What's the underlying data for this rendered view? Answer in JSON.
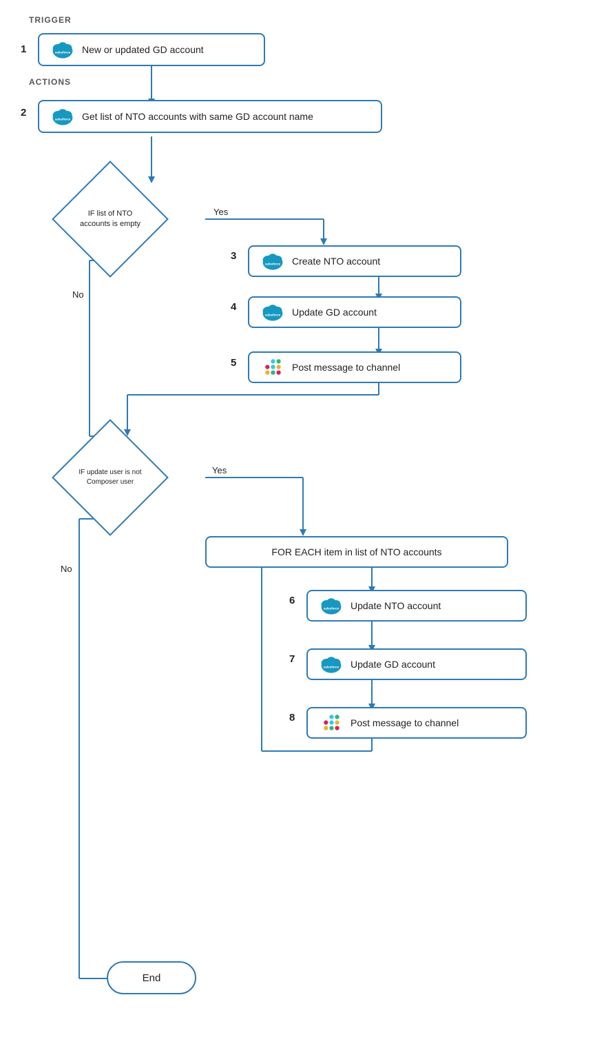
{
  "labels": {
    "trigger": "TRIGGER",
    "actions": "ACTIONS"
  },
  "nodes": {
    "step1": {
      "number": "1",
      "text": "New or updated GD account"
    },
    "step2": {
      "number": "2",
      "text": "Get list of NTO accounts with same GD account name"
    },
    "diamond1": {
      "text": "IF list of\nNTO accounts\nis empty"
    },
    "diamond1_yes": "Yes",
    "diamond1_no": "No",
    "step3": {
      "number": "3",
      "text": "Create NTO account"
    },
    "step4": {
      "number": "4",
      "text": "Update GD account"
    },
    "step5": {
      "number": "5",
      "text": "Post message to channel"
    },
    "diamond2": {
      "text": "IF\nupdate user is\nnot Composer\nuser"
    },
    "diamond2_yes": "Yes",
    "diamond2_no": "No",
    "foreach": {
      "text": "FOR EACH item in list of NTO accounts"
    },
    "step6": {
      "number": "6",
      "text": "Update NTO account"
    },
    "step7": {
      "number": "7",
      "text": "Update GD account"
    },
    "step8": {
      "number": "8",
      "text": "Post message to channel"
    },
    "end": "End"
  },
  "colors": {
    "border": "#2e7ab5",
    "text": "#222222",
    "label": "#666666",
    "sf_blue": "#1798c1",
    "slack_purple": "#611f69"
  }
}
